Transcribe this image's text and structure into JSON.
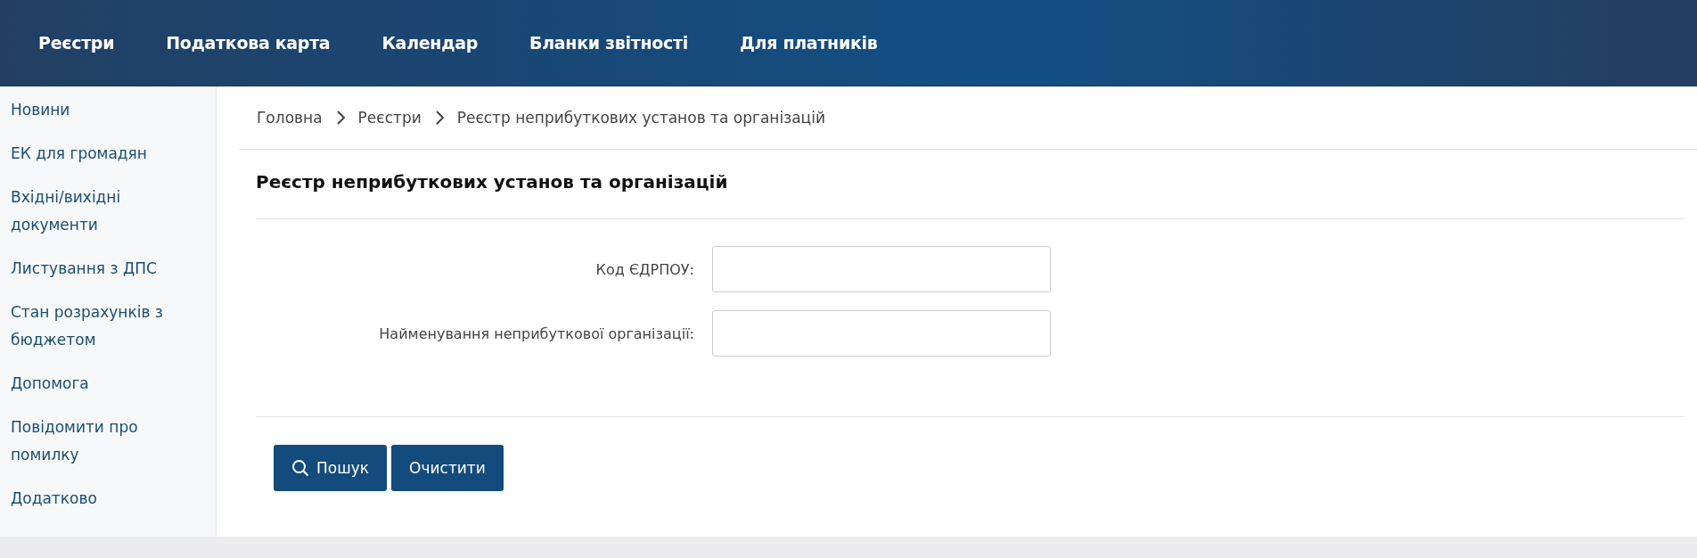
{
  "top_nav": {
    "items": [
      "Реєстри",
      "Податкова карта",
      "Календар",
      "Бланки звітності",
      "Для платників"
    ]
  },
  "sidebar": {
    "items": [
      "Новини",
      "ЕК для громадян",
      "Вхідні/вихідні документи",
      "Листування з ДПС",
      "Стан розрахунків з бюджетом",
      "Допомога",
      "Повідомити про помилку",
      "Додатково"
    ]
  },
  "breadcrumb": [
    "Головна",
    "Реєстри",
    "Реєстр неприбуткових установ та організацій"
  ],
  "page_title": "Реєстр неприбуткових установ та організацій",
  "form": {
    "fields": [
      {
        "label": "Код ЄДРПОУ:"
      },
      {
        "label": "Найменування неприбуткової організації:"
      }
    ]
  },
  "buttons": [
    {
      "kind": "search",
      "label": "Пошук"
    },
    {
      "kind": "plain",
      "label": "Очистити"
    }
  ]
}
